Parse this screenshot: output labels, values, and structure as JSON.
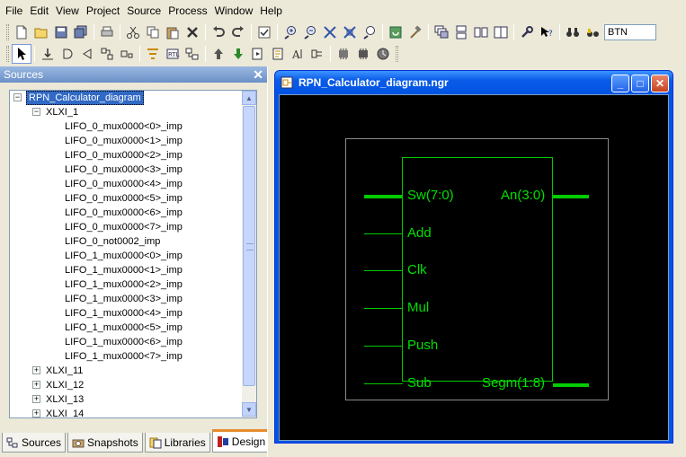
{
  "menubar": {
    "items": [
      "File",
      "Edit",
      "View",
      "Project",
      "Source",
      "Process",
      "Window",
      "Help"
    ]
  },
  "toolbar": {
    "search_value": "BTN"
  },
  "sources_panel": {
    "title": "Sources",
    "tree": {
      "root": "RPN_Calculator_diagram",
      "child": "XLXI_1",
      "instances": [
        "LIFO_0_mux0000<0>_imp",
        "LIFO_0_mux0000<1>_imp",
        "LIFO_0_mux0000<2>_imp",
        "LIFO_0_mux0000<3>_imp",
        "LIFO_0_mux0000<4>_imp",
        "LIFO_0_mux0000<5>_imp",
        "LIFO_0_mux0000<6>_imp",
        "LIFO_0_mux0000<7>_imp",
        "LIFO_0_not0002_imp",
        "LIFO_1_mux0000<0>_imp",
        "LIFO_1_mux0000<1>_imp",
        "LIFO_1_mux0000<2>_imp",
        "LIFO_1_mux0000<3>_imp",
        "LIFO_1_mux0000<4>_imp",
        "LIFO_1_mux0000<5>_imp",
        "LIFO_1_mux0000<6>_imp",
        "LIFO_1_mux0000<7>_imp"
      ],
      "collapsed": [
        "XLXI_11",
        "XLXI_12",
        "XLXI_13",
        "XLXI_14"
      ]
    },
    "tabs": [
      "Sources",
      "Snapshots",
      "Libraries",
      "Design"
    ],
    "active_tab": "Design"
  },
  "schematic_window": {
    "title": "RPN_Calculator_diagram.ngr",
    "pins_left": [
      "Sw(7:0)",
      "Add",
      "Clk",
      "Mul",
      "Push",
      "Sub"
    ],
    "pins_right": [
      "An(3:0)",
      "Segm(1:8)"
    ],
    "colors": {
      "canvas": "#000000",
      "symbol": "#00cc00",
      "frame": "#8a8a8a"
    }
  }
}
